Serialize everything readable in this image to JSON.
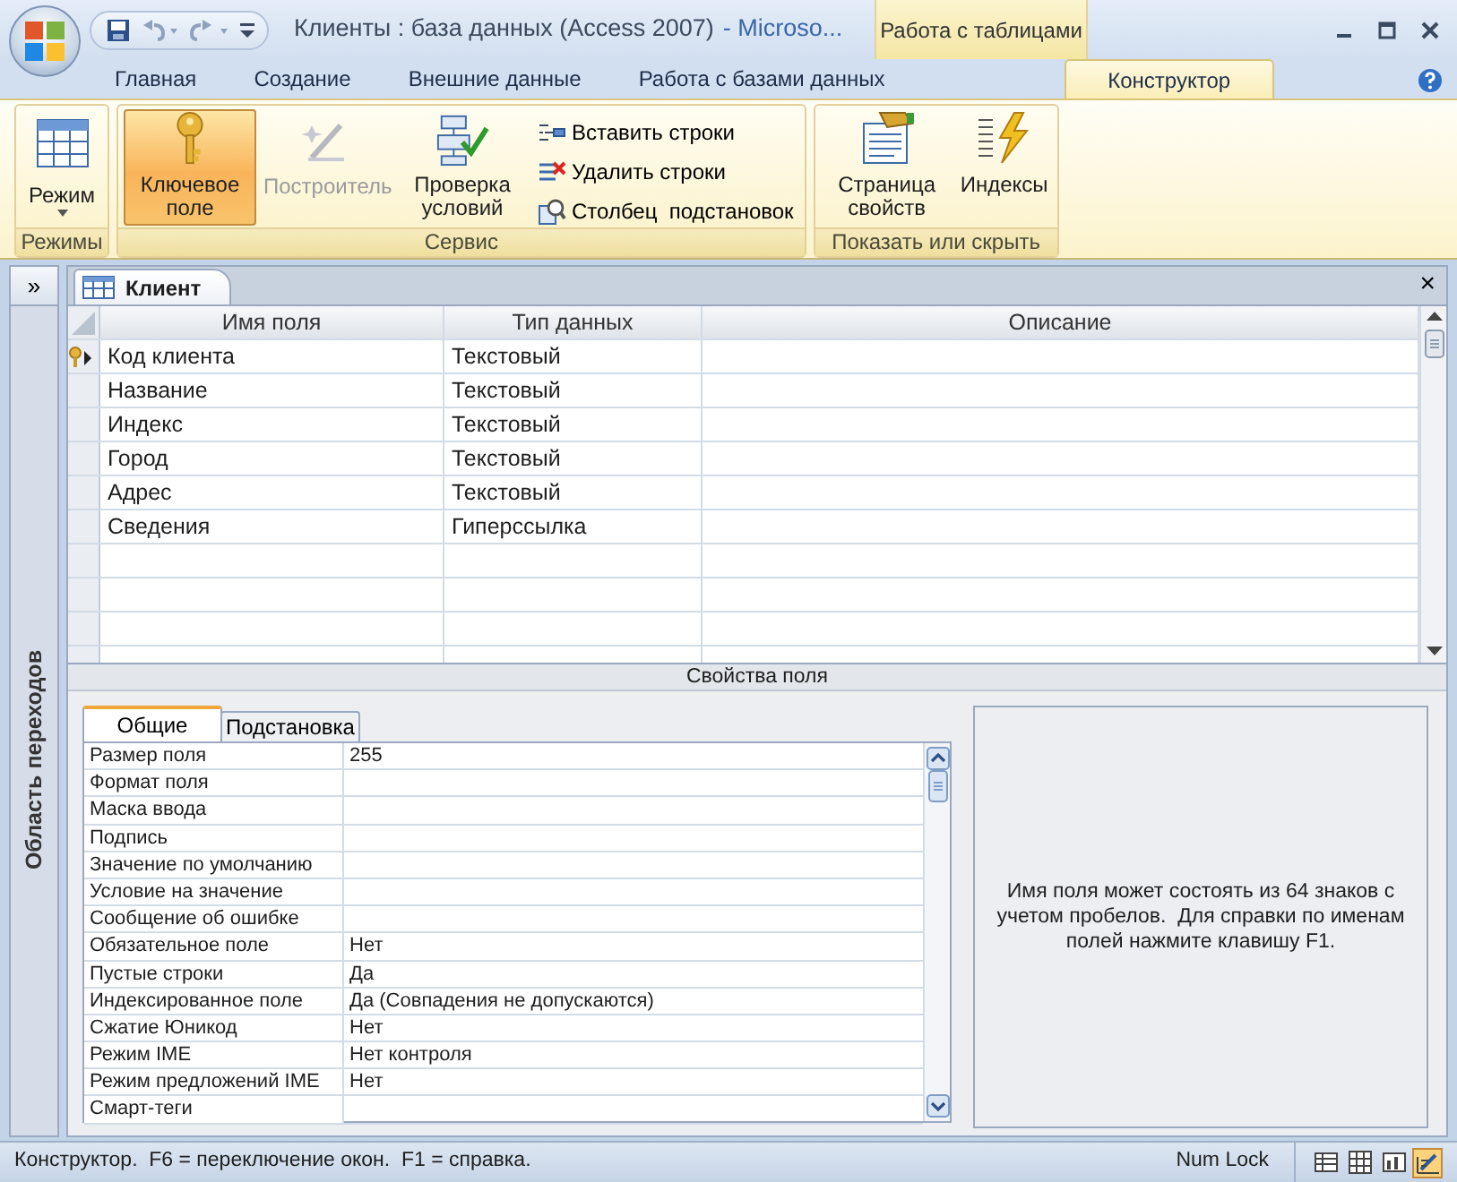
{
  "window": {
    "document_title": "Клиенты : база данных (Access 2007)",
    "app_title": "- Microso..."
  },
  "contextual_tab_group": {
    "label": "Работа с таблицами"
  },
  "ribbon": {
    "tabs": [
      {
        "label": "Главная",
        "selected": false
      },
      {
        "label": "Создание",
        "selected": false
      },
      {
        "label": "Внешние данные",
        "selected": false
      },
      {
        "label": "Работа с базами данных",
        "selected": false
      },
      {
        "label": "Конструктор",
        "selected": true
      }
    ],
    "groups": [
      {
        "label": "Режимы",
        "buttons": [
          {
            "kind": "menu",
            "label": "Режим",
            "selected": false,
            "disabled": false
          }
        ]
      },
      {
        "label": "Сервис",
        "buttons": [
          {
            "kind": "large",
            "label": "Ключевое поле",
            "selected": true,
            "disabled": false
          },
          {
            "kind": "large",
            "label": "Построитель",
            "selected": false,
            "disabled": true
          },
          {
            "kind": "large",
            "label": "Проверка условий",
            "selected": false,
            "disabled": false
          },
          {
            "kind": "small",
            "label": "Вставить строки",
            "selected": false,
            "disabled": false
          },
          {
            "kind": "small",
            "label": "Удалить строки",
            "selected": false,
            "disabled": false
          },
          {
            "kind": "small",
            "label": "Столбец  подстановок",
            "selected": false,
            "disabled": false
          }
        ]
      },
      {
        "label": "Показать или скрыть",
        "buttons": [
          {
            "kind": "large",
            "label": "Страница свойств",
            "selected": false,
            "disabled": false
          },
          {
            "kind": "large",
            "label": "Индексы",
            "selected": false,
            "disabled": false
          }
        ]
      }
    ]
  },
  "navigation_pane": {
    "toggle": "»",
    "title": "Область переходов"
  },
  "document_tab": {
    "label": "Клиент",
    "close": "×"
  },
  "design_grid": {
    "columns": [
      "Имя поля",
      "Тип данных",
      "Описание"
    ],
    "rows": [
      {
        "name": "Код клиента",
        "type": "Текстовый",
        "primary_key": true,
        "current": true
      },
      {
        "name": "Название",
        "type": "Текстовый",
        "primary_key": false,
        "current": false
      },
      {
        "name": "Индекс",
        "type": "Текстовый",
        "primary_key": false,
        "current": false
      },
      {
        "name": "Город",
        "type": "Текстовый",
        "primary_key": false,
        "current": false
      },
      {
        "name": "Адрес",
        "type": "Текстовый",
        "primary_key": false,
        "current": false
      },
      {
        "name": "Сведения",
        "type": "Гиперссылка",
        "primary_key": false,
        "current": false
      }
    ]
  },
  "field_properties": {
    "title": "Свойства поля",
    "tabs": [
      {
        "label": "Общие",
        "selected": true
      },
      {
        "label": "Подстановка",
        "selected": false
      }
    ],
    "rows": [
      {
        "label": "Размер поля",
        "value": "255"
      },
      {
        "label": "Формат поля"
      },
      {
        "label": "Маска ввода"
      },
      {
        "label": "Подпись"
      },
      {
        "label": "Значение по умолчанию"
      },
      {
        "label": "Условие на значение"
      },
      {
        "label": "Сообщение об ошибке"
      },
      {
        "label": "Обязательное поле",
        "value": "Нет"
      },
      {
        "label": "Пустые строки",
        "value": "Да"
      },
      {
        "label": "Индексированное поле",
        "value": "Да (Совпадения не допускаются)"
      },
      {
        "label": "Сжатие Юникод",
        "value": "Нет"
      },
      {
        "label": "Режим IME",
        "value": "Нет контроля"
      },
      {
        "label": "Режим предложений IME",
        "value": "Нет"
      },
      {
        "label": "Смарт-теги"
      }
    ],
    "help_text": "Имя поля может состоять из 64 знаков с учетом пробелов.  Для справки по именам полей нажмите клавишу F1."
  },
  "status_bar": {
    "text": "Конструктор.  F6 = переключение окон.  F1 = справка.",
    "num_lock": "Num Lock",
    "views": [
      {
        "selected": false
      },
      {
        "selected": false
      },
      {
        "selected": false
      },
      {
        "selected": true
      }
    ]
  }
}
